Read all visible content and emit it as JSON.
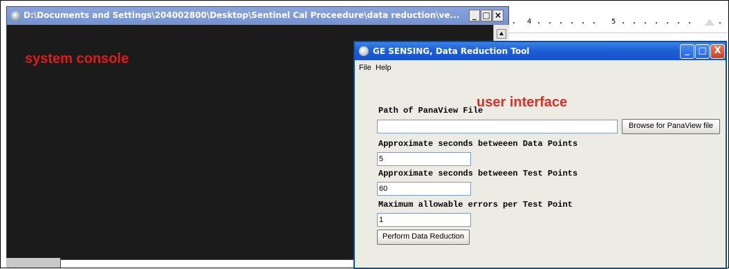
{
  "console_window": {
    "title": "D:\\Documents and Settings\\204002800\\Desktop\\Sentinel Cal Proceedure\\data reduction\\ve...",
    "label": "system console",
    "minimize_label": "_",
    "maximize_label": "□",
    "close_label": "×",
    "icon": "app-icon"
  },
  "ruler": {
    "numbers": [
      "4",
      "5"
    ]
  },
  "ui_window": {
    "title": "GE SENSING, Data Reduction Tool",
    "minimize_label": "_",
    "maximize_label": "□",
    "close_label": "X",
    "menu": [
      "File",
      "Help"
    ],
    "label": "user interface",
    "path_label": "Path of PanaView File",
    "path_value": "",
    "browse_button": "Browse for PanaView file",
    "data_points_label": "Approximate seconds betweeen Data Points",
    "data_points_value": "5",
    "test_points_label": "Approximate seconds betweeen Test Points",
    "test_points_value": "60",
    "errors_label": "Maximum allowable errors per Test Point",
    "errors_value": "1",
    "perform_button": "Perform Data Reduction"
  },
  "colors": {
    "console_bg": "#1b1b1b",
    "label_red": "#e21a1a",
    "xp_blue": "#1e5fd6"
  }
}
